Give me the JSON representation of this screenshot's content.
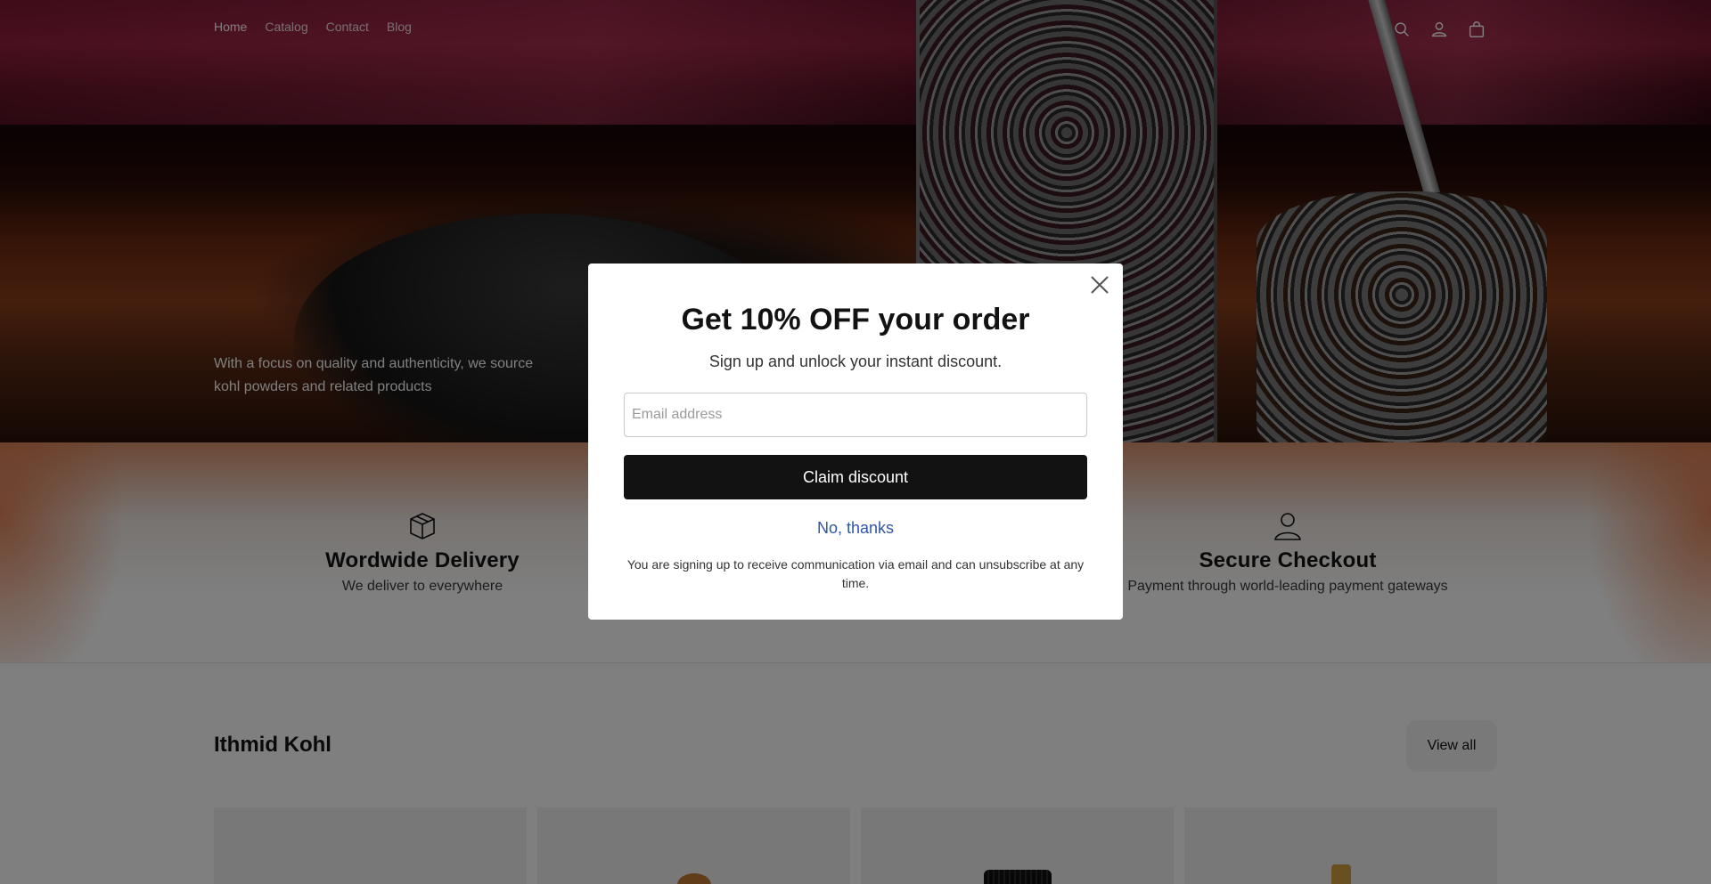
{
  "header": {
    "nav": [
      {
        "label": "Home"
      },
      {
        "label": "Catalog"
      },
      {
        "label": "Contact"
      },
      {
        "label": "Blog"
      }
    ],
    "icons": [
      "search-icon",
      "account-icon",
      "cart-icon"
    ]
  },
  "hero": {
    "text": "With a focus on quality and authenticity, we source kohl powders and related products"
  },
  "features": {
    "left": {
      "icon": "box-icon",
      "title": "Wordwide Delivery",
      "subtitle": "We deliver to everywhere"
    },
    "right": {
      "icon": "user-icon",
      "title": "Secure Checkout",
      "subtitle": "Payment through world-leading payment gateways"
    }
  },
  "collection": {
    "title": "Ithmid Kohl",
    "view_all_label": "View all",
    "product_count_visible": 4
  },
  "popup": {
    "title": "Get 10% OFF your order",
    "subtitle": "Sign up and unlock your instant discount.",
    "email_placeholder": "Email address",
    "claim_label": "Claim discount",
    "decline_label": "No, thanks",
    "disclaimer": "You are signing up to receive communication via email and can unsubscribe at any time.",
    "close_icon": "close-icon"
  },
  "colors": {
    "button_dark": "#121212",
    "link_blue": "#2f56a6",
    "overlay": "rgba(0,0,0,0.5)"
  }
}
